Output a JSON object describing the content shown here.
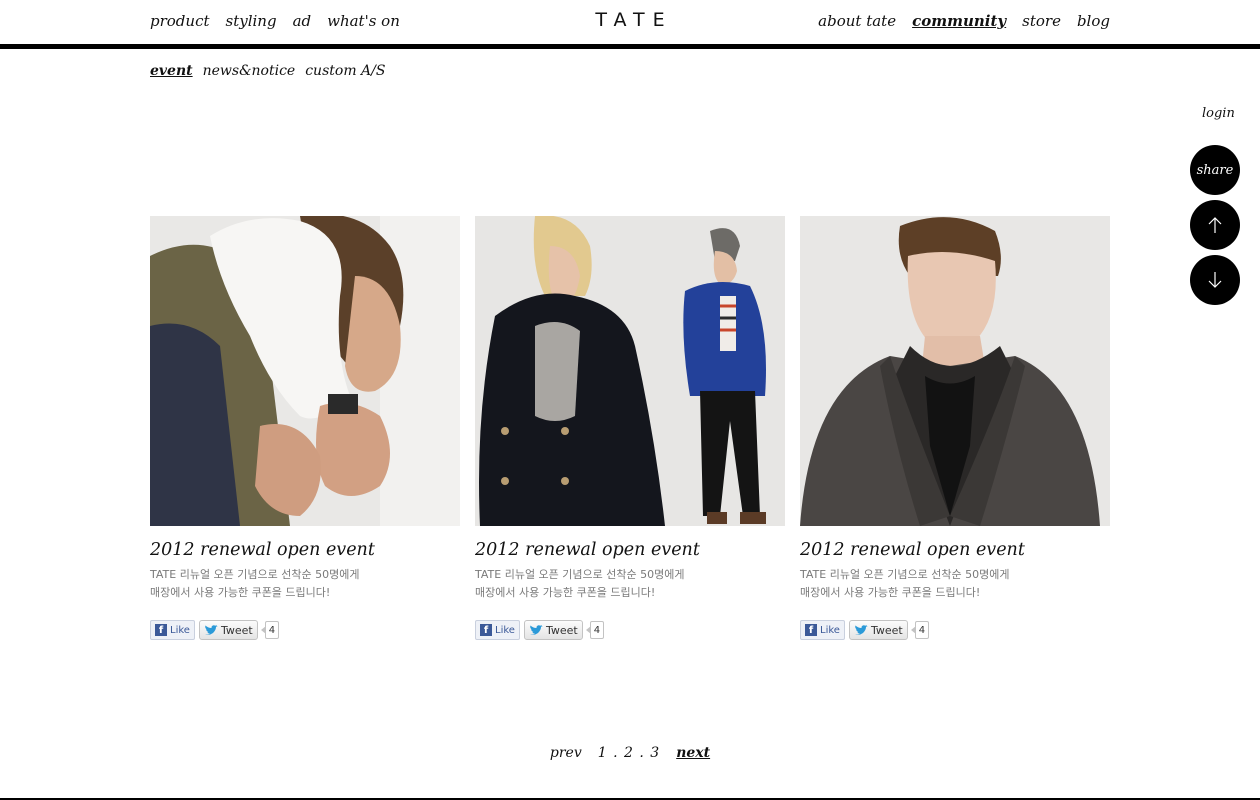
{
  "header": {
    "logo": "TATE",
    "nav_left": [
      "product",
      "styling",
      "ad",
      "what's on"
    ],
    "nav_right": [
      "about tate",
      "community",
      "store",
      "blog"
    ],
    "active": "community"
  },
  "subnav": {
    "items": [
      "event",
      "news&notice",
      "custom A/S"
    ],
    "active": "event"
  },
  "side": {
    "login": "login",
    "share": "share",
    "up_icon": "arrow-up-icon",
    "down_icon": "arrow-down-icon"
  },
  "cards": [
    {
      "title": "2012 renewal open event",
      "desc_line1": "TATE 리뉴얼 오픈 기념으로 선착순 50명에게",
      "desc_line2": "매장에서 사용 가능한 쿠폰을 드립니다!",
      "like_label": "Like",
      "tweet_label": "Tweet",
      "tweet_count": "4"
    },
    {
      "title": "2012 renewal open event",
      "desc_line1": "TATE 리뉴얼 오픈 기념으로 선착순 50명에게",
      "desc_line2": "매장에서 사용 가능한 쿠폰을 드립니다!",
      "like_label": "Like",
      "tweet_label": "Tweet",
      "tweet_count": "4"
    },
    {
      "title": "2012 renewal open event",
      "desc_line1": "TATE 리뉴얼 오픈 기념으로 선착순 50명에게",
      "desc_line2": "매장에서 사용 가능한 쿠폰을 드립니다!",
      "like_label": "Like",
      "tweet_label": "Tweet",
      "tweet_count": "4"
    }
  ],
  "pagination": {
    "prev": "prev",
    "pages": "1 . 2 . 3",
    "next": "next"
  },
  "colors": {
    "black": "#000000",
    "desc_gray": "#7a7a7a",
    "facebook_blue": "#3b5998"
  }
}
